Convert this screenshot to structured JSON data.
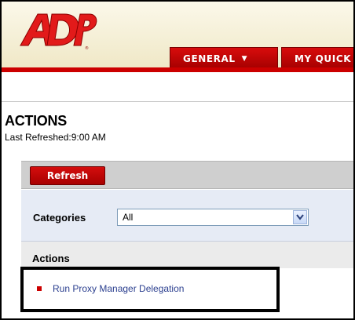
{
  "header": {
    "logo_text": "ADP",
    "tabs": [
      {
        "label": "GENERAL",
        "icon": "chevron-down-icon"
      },
      {
        "label": "MY QUICK"
      }
    ]
  },
  "page": {
    "title": "ACTIONS",
    "last_refreshed": "Last Refreshed:9:00 AM"
  },
  "toolbar": {
    "refresh_label": "Refresh"
  },
  "filters": {
    "categories_label": "Categories",
    "categories_value": "All"
  },
  "actions": {
    "section_label": "Actions",
    "items": [
      {
        "label": "Run Proxy Manager Delegation"
      }
    ]
  },
  "colors": {
    "brand_red": "#cc0000",
    "link_blue": "#2b3f8f"
  }
}
